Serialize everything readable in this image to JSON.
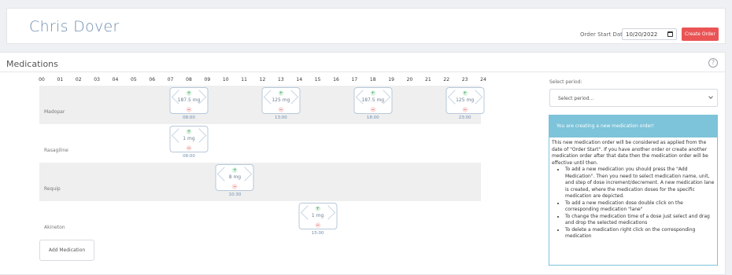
{
  "header": {
    "patient_name": "Chris Dover",
    "order_start_label": "Order Start Date:",
    "order_start_date": "10/20/2022",
    "create_order_label": "Create Order"
  },
  "medications_panel": {
    "title": "Medications",
    "help_glyph": "?",
    "hours": [
      "00",
      "01",
      "02",
      "03",
      "04",
      "05",
      "06",
      "07",
      "08",
      "09",
      "10",
      "11",
      "12",
      "13",
      "14",
      "15",
      "16",
      "17",
      "18",
      "19",
      "20",
      "21",
      "22",
      "23",
      "24"
    ],
    "lanes": [
      {
        "name": "Madopar",
        "doses": [
          {
            "hour": 8,
            "amount": "187.5 mg",
            "time": "08:00"
          },
          {
            "hour": 13,
            "amount": "125 mg",
            "time": "13:00"
          },
          {
            "hour": 18,
            "amount": "187.5 mg",
            "time": "18:00"
          },
          {
            "hour": 23,
            "amount": "125 mg",
            "time": "23:00"
          }
        ]
      },
      {
        "name": "Rasagiline",
        "doses": [
          {
            "hour": 8,
            "amount": "1 mg",
            "time": "08:00"
          }
        ]
      },
      {
        "name": "Requip",
        "doses": [
          {
            "hour": 10.5,
            "amount": "8 mg",
            "time": "10:30"
          }
        ]
      },
      {
        "name": "Akineton",
        "doses": [
          {
            "hour": 15,
            "amount": "1 mg",
            "time": "15:00"
          }
        ]
      }
    ],
    "add_medication_label": "Add Medication",
    "plus_glyph": "+",
    "minus_glyph": "−"
  },
  "side_panel": {
    "select_period_label": "Select period:",
    "select_period_placeholder": "Select period...",
    "info_title": "You are creating a new medication order!",
    "info_intro": "This new medication order will be considered as applied from the date of \"Order Start\". If you have another order or create another medication order after that date then the medication order will be effective until then.",
    "info_items": [
      "To add a new medication you should press the \"Add Medication\". Then you need to select medication name, unit, and step of dose increment/decrement. A new medication lane is created, where the medication doses for the specific medication are depicted.",
      "To add a new medication dose double click on the corresponding medication \"lane\"",
      "To change the medication time of a dose just select and drag and drop the selected medications",
      "To delete a medication right click on the corresponding medication"
    ]
  },
  "colors": {
    "accent_blue": "#6f8fb0",
    "create_button": "#ea5455",
    "info_header": "#7dc3d9"
  }
}
